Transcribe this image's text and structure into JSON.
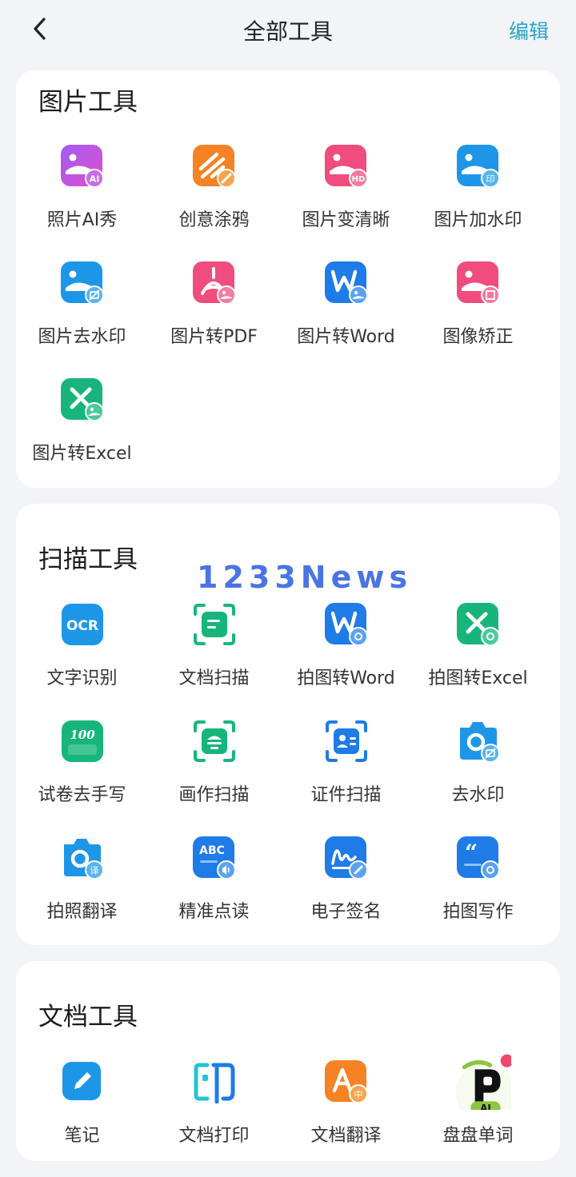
{
  "header": {
    "title": "全部工具",
    "edit": "编辑"
  },
  "watermark": "1233News",
  "sections": [
    {
      "title": "图片工具",
      "items": [
        {
          "label": "照片AI秀",
          "icon": "photo-ai-icon"
        },
        {
          "label": "创意涂鸦",
          "icon": "doodle-icon"
        },
        {
          "label": "图片变清晰",
          "icon": "photo-hd-icon"
        },
        {
          "label": "图片加水印",
          "icon": "add-watermark-icon"
        },
        {
          "label": "图片去水印",
          "icon": "remove-watermark-icon"
        },
        {
          "label": "图片转PDF",
          "icon": "image-to-pdf-icon"
        },
        {
          "label": "图片转Word",
          "icon": "image-to-word-icon"
        },
        {
          "label": "图像矫正",
          "icon": "image-correct-icon"
        },
        {
          "label": "图片转Excel",
          "icon": "image-to-excel-icon"
        }
      ]
    },
    {
      "title": "扫描工具",
      "items": [
        {
          "label": "文字识别",
          "icon": "ocr-icon"
        },
        {
          "label": "文档扫描",
          "icon": "doc-scan-icon"
        },
        {
          "label": "拍图转Word",
          "icon": "photo-to-word-icon"
        },
        {
          "label": "拍图转Excel",
          "icon": "photo-to-excel-icon"
        },
        {
          "label": "试卷去手写",
          "icon": "exam-icon"
        },
        {
          "label": "画作扫描",
          "icon": "painting-scan-icon"
        },
        {
          "label": "证件扫描",
          "icon": "id-scan-icon"
        },
        {
          "label": "去水印",
          "icon": "camera-watermark-icon"
        },
        {
          "label": "拍照翻译",
          "icon": "photo-translate-icon"
        },
        {
          "label": "精准点读",
          "icon": "read-aloud-icon"
        },
        {
          "label": "电子签名",
          "icon": "signature-icon"
        },
        {
          "label": "拍图写作",
          "icon": "photo-writing-icon"
        }
      ]
    },
    {
      "title": "文档工具",
      "items": [
        {
          "label": "笔记",
          "icon": "note-icon"
        },
        {
          "label": "文档打印",
          "icon": "doc-print-icon"
        },
        {
          "label": "文档翻译",
          "icon": "doc-translate-icon"
        },
        {
          "label": "盘盘单词",
          "icon": "panpan-words-icon"
        }
      ]
    }
  ],
  "icon_text": {
    "ai": "AI",
    "hd": "HD",
    "yin": "印",
    "ocr": "OCR",
    "hundred": "100",
    "abc": "ABC",
    "yi": "译",
    "zhong": "中",
    "quote": "“",
    "ai2": "AI"
  }
}
